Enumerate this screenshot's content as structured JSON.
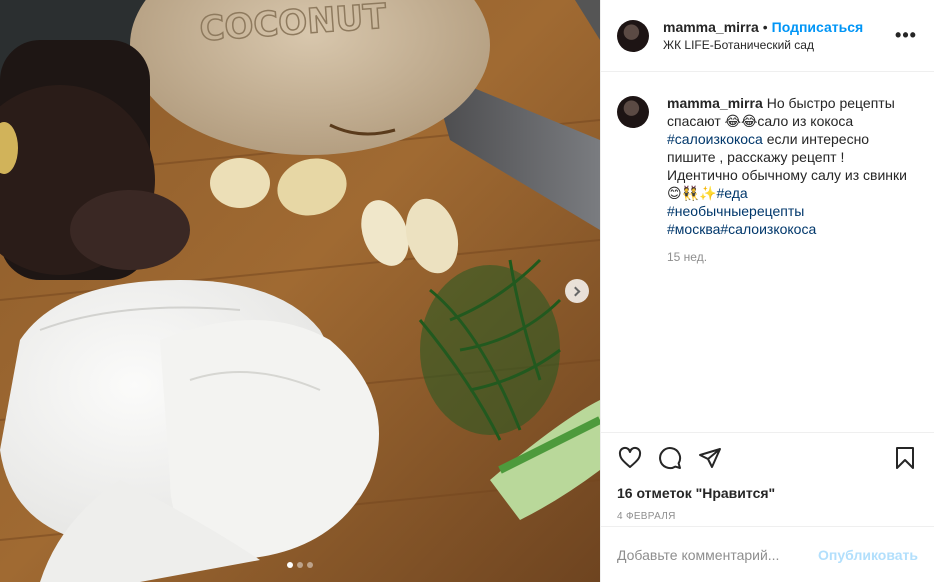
{
  "post": {
    "username": "mamma_mirra",
    "separator": "•",
    "follow_label": "Подписаться",
    "location": "ЖК LIFE-Ботанический сад",
    "more_label": "•••",
    "caption": {
      "username": "mamma_mirra",
      "text_1": "Но быстро рецепты спасают 😂😂сало из кокоса ",
      "tag_1": "#салоизкокоса",
      "text_2": " если интересно пишите , расскажу рецепт ! Идентично обычному салу из свинки 😊👯✨",
      "tag_2": "#еда",
      "tag_3": "#необычныерецепты",
      "tag_4": "#москва",
      "tag_5": "#салоизкокоса"
    },
    "time_ago": "15 нед.",
    "likes": "16 отметок \"Нравится\"",
    "date": "4 ФЕВРАЛЯ",
    "comment_placeholder": "Добавьте комментарий...",
    "publish_label": "Опубликовать",
    "photo_brand_text": "COCONUT",
    "carousel": {
      "current": 1,
      "total": 3
    }
  },
  "icons": {
    "like": "heart-icon",
    "comment": "comment-icon",
    "share": "share-icon",
    "save": "bookmark-icon",
    "next": "chevron-right-icon"
  },
  "colors": {
    "accent": "#0095f6",
    "hashtag": "#00376b",
    "publish_disabled": "#b2dffc",
    "muted": "#8e8e8e",
    "text": "#262626"
  }
}
